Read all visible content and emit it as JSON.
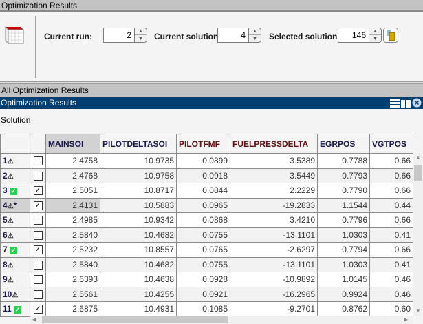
{
  "window_title": "Optimization Results",
  "toolbar": {
    "current_run_label": "Current run:",
    "current_run": "2",
    "current_solution_label": "Current solution:",
    "current_solution": "4",
    "selected_solution_label": "Selected solution:",
    "selected_solution": "146"
  },
  "section_title": "All Optimization Results",
  "panel_title": "Optimization Results",
  "solution_label": "Solution",
  "colors": {
    "panel_bar": "#003f72",
    "ok": "#2ecc55"
  },
  "table": {
    "columns": [
      "MAINSOI",
      "PILOTDELTASOI",
      "PILOTFMF",
      "FUELPRESSDELTA",
      "EGRPOS",
      "VGTPOS"
    ],
    "rows": [
      {
        "id": "1",
        "status": "warning",
        "marker": "",
        "checked": false,
        "values": [
          "2.4758",
          "10.9735",
          "0.0899",
          "3.5389",
          "0.7788",
          "0.66"
        ]
      },
      {
        "id": "2",
        "status": "warning",
        "marker": "",
        "checked": false,
        "values": [
          "2.4768",
          "10.9758",
          "0.0918",
          "3.5449",
          "0.7793",
          "0.66"
        ]
      },
      {
        "id": "3",
        "status": "ok",
        "marker": "",
        "checked": true,
        "values": [
          "2.5051",
          "10.8717",
          "0.0844",
          "2.2229",
          "0.7790",
          "0.66"
        ]
      },
      {
        "id": "4",
        "status": "warning",
        "marker": "*",
        "checked": true,
        "values": [
          "2.4131",
          "10.5883",
          "0.0965",
          "-19.2833",
          "1.1544",
          "0.44"
        ]
      },
      {
        "id": "5",
        "status": "warning",
        "marker": "",
        "checked": false,
        "values": [
          "2.4985",
          "10.9342",
          "0.0868",
          "3.4210",
          "0.7796",
          "0.66"
        ]
      },
      {
        "id": "6",
        "status": "warning",
        "marker": "",
        "checked": false,
        "values": [
          "2.5840",
          "10.4682",
          "0.0755",
          "-13.1101",
          "1.0303",
          "0.41"
        ]
      },
      {
        "id": "7",
        "status": "ok",
        "marker": "",
        "checked": true,
        "values": [
          "2.5232",
          "10.8557",
          "0.0765",
          "-2.6297",
          "0.7794",
          "0.66"
        ]
      },
      {
        "id": "8",
        "status": "warning",
        "marker": "",
        "checked": false,
        "values": [
          "2.5840",
          "10.4682",
          "0.0755",
          "-13.1101",
          "1.0303",
          "0.41"
        ]
      },
      {
        "id": "9",
        "status": "warning",
        "marker": "",
        "checked": false,
        "values": [
          "2.6393",
          "10.4638",
          "0.0928",
          "-10.9892",
          "1.0145",
          "0.46"
        ]
      },
      {
        "id": "10",
        "status": "warning",
        "marker": "",
        "checked": false,
        "values": [
          "2.5561",
          "10.4255",
          "0.0921",
          "-16.2965",
          "0.9924",
          "0.46"
        ]
      },
      {
        "id": "11",
        "status": "ok",
        "marker": "",
        "checked": true,
        "values": [
          "2.6875",
          "10.4931",
          "0.1085",
          "-9.2701",
          "0.8762",
          "0.60"
        ]
      }
    ]
  }
}
